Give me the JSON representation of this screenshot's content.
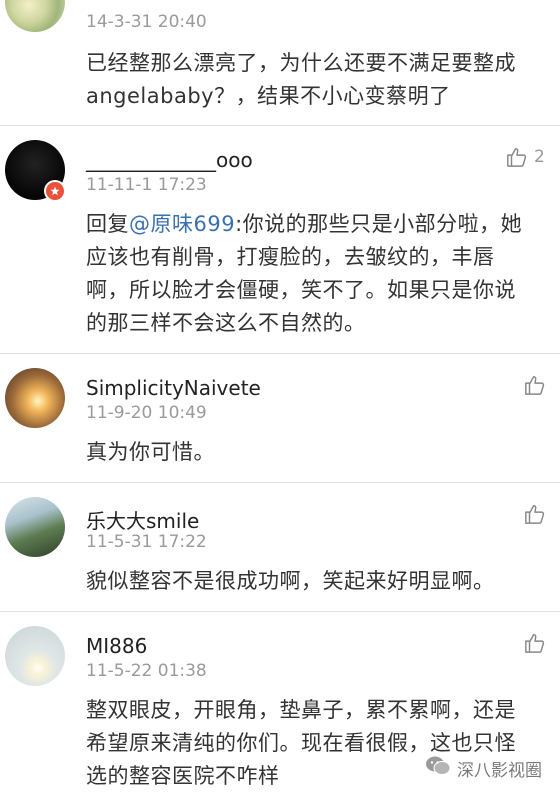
{
  "comments": [
    {
      "time": "14-3-31 20:40",
      "text": "已经整那么漂亮了，为什么还要不满足要整成angelababy？，结果不小心变蔡明了"
    },
    {
      "name": "_____________ooo",
      "time": "11-11-1 17:23",
      "reply_prefix": "回复",
      "mention": "@原味699",
      "text": ":你说的那些只是小部分啦，她应该也有削骨，打瘦脸的，去皱纹的，丰唇啊，所以脸才会僵硬，笑不了。如果只是你说的那三样不会这么不自然的。",
      "likes": "2"
    },
    {
      "name": "SimplicityNaivete",
      "time": "11-9-20 10:49",
      "text": "真为你可惜。"
    },
    {
      "name": "乐大大smile",
      "time": "11-5-31 17:22",
      "text": "貌似整容不是很成功啊，笑起来好明显啊。"
    },
    {
      "name": "MI886",
      "time": "11-5-22 01:38",
      "text": "整双眼皮，开眼角，垫鼻子，累不累啊，还是希望原来清纯的你们。现在看很假，这也只怪选的整容医院不咋样"
    }
  ],
  "watermark": "深八影视圈",
  "icons": {
    "like": "thumbs-up-icon",
    "badge": "verified-badge-icon",
    "watermark": "wechat-icon"
  }
}
